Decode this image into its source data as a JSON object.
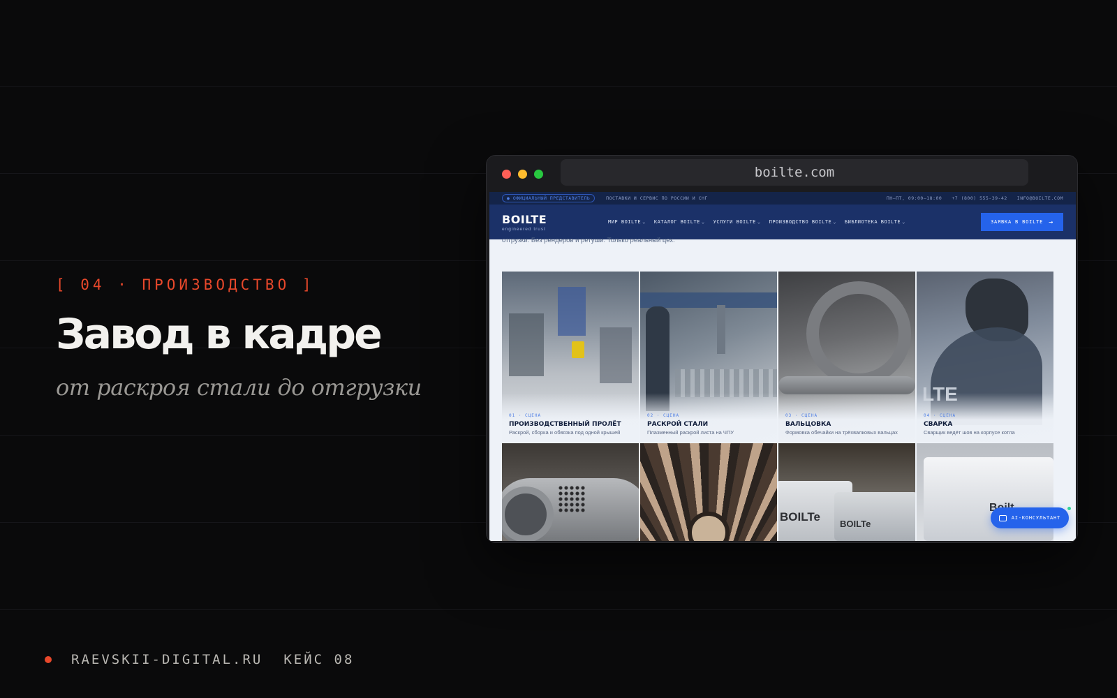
{
  "slide": {
    "tag": "[ 04 · ПРОИЗВОДСТВО ]",
    "title": "Завод в кадре",
    "subtitle": "от раскроя стали до отгрузки",
    "footer": {
      "site": "RAEVSKII-DIGITAL.RU",
      "case": "КЕЙС 08"
    },
    "accent_color": "#e8482b"
  },
  "browser": {
    "url": "boilte.com",
    "traffic_lights": [
      "close",
      "minimize",
      "maximize"
    ]
  },
  "site": {
    "topbar": {
      "badge": "● ОФИЦИАЛЬНЫЙ ПРЕДСТАВИТЕЛЬ",
      "tagline": "ПОСТАВКИ И СЕРВИС ПО РОССИИ И СНГ",
      "hours": "ПН–ПТ, 09:00–18:00",
      "phone": "+7 (800) 555-39-42",
      "email": "INFO@BOILTE.COM"
    },
    "logo": {
      "name": "BOILTE",
      "tagline": "engineered trust"
    },
    "nav": [
      {
        "label": "МИР BOILTE"
      },
      {
        "label": "КАТАЛОГ BOILTE"
      },
      {
        "label": "УСЛУГИ BOILTE"
      },
      {
        "label": "ПРОИЗВОДСТВО BOILTE"
      },
      {
        "label": "БИБЛИОТЕКА BOILTE"
      }
    ],
    "cta": "ЗАЯВКА В BOILTE",
    "intro": "отгрузки. Без рендеров и ретуши. Только реальный цех.",
    "scenes": [
      {
        "num": "01 · СЦЕНА",
        "title": "ПРОИЗВОДСТВЕННЫЙ ПРОЛЁТ",
        "desc": "Раскрой, сборка и обвязка под одной крышей"
      },
      {
        "num": "02 · СЦЕНА",
        "title": "РАСКРОЙ СТАЛИ",
        "desc": "Плазменный раскрой листа на ЧПУ"
      },
      {
        "num": "03 · СЦЕНА",
        "title": "ВАЛЬЦОВКА",
        "desc": "Формовка обечайки на трёхвалковых вальцах"
      },
      {
        "num": "04 · СЦЕНА",
        "title": "СВАРКА",
        "desc": "Сварщик ведёт шов на корпусе котла"
      }
    ],
    "photo_text": {
      "p4": "LTE",
      "p7a": "BOILTe",
      "p7b": "BOILTe",
      "p8": "Boilt"
    },
    "ai_button": "AI-КОНСУЛЬТАНТ",
    "colors": {
      "navy": "#1b3168",
      "topbar": "#142449",
      "blue": "#2563eb",
      "page_bg": "#eef2f8"
    }
  }
}
